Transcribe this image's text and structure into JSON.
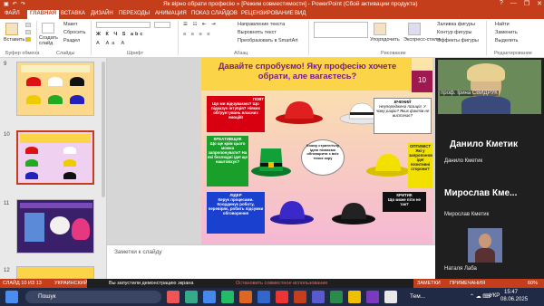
{
  "window": {
    "title": "Як вірно обрати професію » [Режим совместимости] - PowerPoint (Сбой активации продукта)",
    "controls": [
      "?",
      "—",
      "❐",
      "✕"
    ]
  },
  "ribbon_tabs": [
    "ФАЙЛ",
    "ГЛАВНАЯ",
    "ВСТАВКА",
    "ДИЗАЙН",
    "ПЕРЕХОДЫ",
    "АНИМАЦИЯ",
    "ПОКАЗ СЛАЙДОВ",
    "РЕЦЕНЗИРОВАНИЕ",
    "ВИД"
  ],
  "active_tab": "ГЛАВНАЯ",
  "ribbon": {
    "paste": "Вставить",
    "create_slide": "Создать слайд",
    "layout": "Макет",
    "reset": "Сбросить",
    "section": "Раздел",
    "clipboard_group": "Буфер обмена",
    "slides_group": "Слайды",
    "font_group": "Шрифт",
    "paragraph_group": "Абзац",
    "text_direction": "Направление текста",
    "align_text": "Выровнять текст",
    "smartart": "Преобразовать в SmartArt",
    "arrange": "Упорядочить",
    "express_styles": "Экспресс-стили",
    "fill": "Заливка фигуры",
    "outline": "Контур фигуры",
    "effects": "Эффекты фигуры",
    "find": "Найти",
    "replace": "Заменить",
    "select": "Выделить",
    "editing_group": "Редактирование",
    "drawing_group": "Рисование"
  },
  "thumbnails": [
    {
      "num": "9"
    },
    {
      "num": "10",
      "selected": true
    },
    {
      "num": "11"
    },
    {
      "num": "12"
    }
  ],
  "slide": {
    "title": "Давайте спробуємо! Яку професію хочете обрати, але вагаєтесь?",
    "number": "10",
    "boxes": {
      "white_head": "ПОВТ",
      "white": "Що ми відчуваємо? Що підказує інтуїція? Ніяких обґрунтувань власних емоцій!",
      "wise_head": "ВЧЕНИЙ",
      "wise": "Неупереджена позиція. У чому рацію? Яких фактів не вистачає?",
      "green_head": "КРЕАТИВЩИК",
      "green": "Що ще крім цього можна запропонувати? На які безлюдні ідеї ще наштовхує?",
      "center": "Кожну стратегічну ідею пізнаємо обговорити з всіх точок зору",
      "yellow_head": "ОПТИМІСТ",
      "yellow": "Які у запропонованої ідеї позитивні сторони?",
      "blue_head": "ЛІДЕР",
      "blue": "Керує процесами. Координує роботу, перевіряє, робить підсумки обговорення",
      "black_head": "КРИТИК",
      "black": "Що може піти не так?"
    }
  },
  "notes_placeholder": "Заметки к слайду",
  "participants": {
    "video_label": "проф. Ірина СВИДРУК",
    "tiles": [
      {
        "name": "Данило Кметик",
        "sub": "Данило Кметик"
      },
      {
        "name": "Мирослав Кме...",
        "sub": "Мирослав Кметик"
      },
      {
        "sub": "Наталя Лаба"
      }
    ]
  },
  "statusbar": {
    "slide_info": "СЛАЙД 10 ИЗ 13",
    "language": "УКРАИНСКИЙ",
    "share_info": "Вы запустили демонстрацию экрана",
    "stop_share": "Остановить совместное использование",
    "notes": "ЗАМЕТКИ",
    "comments": "ПРИМЕЧАНИЯ",
    "zoom": "60%"
  },
  "taskbar": {
    "search": "Пошук",
    "weather": "Тем...",
    "lang": "УКР",
    "time": "15:47",
    "date": "08.06.2025"
  },
  "colors": {
    "brand": "#c43e1c",
    "taskbar": "#202a44",
    "slide_bg": "#ffe8b8",
    "slide_title": "#7a1a8a",
    "slide_title_bg": "#fbd448"
  }
}
